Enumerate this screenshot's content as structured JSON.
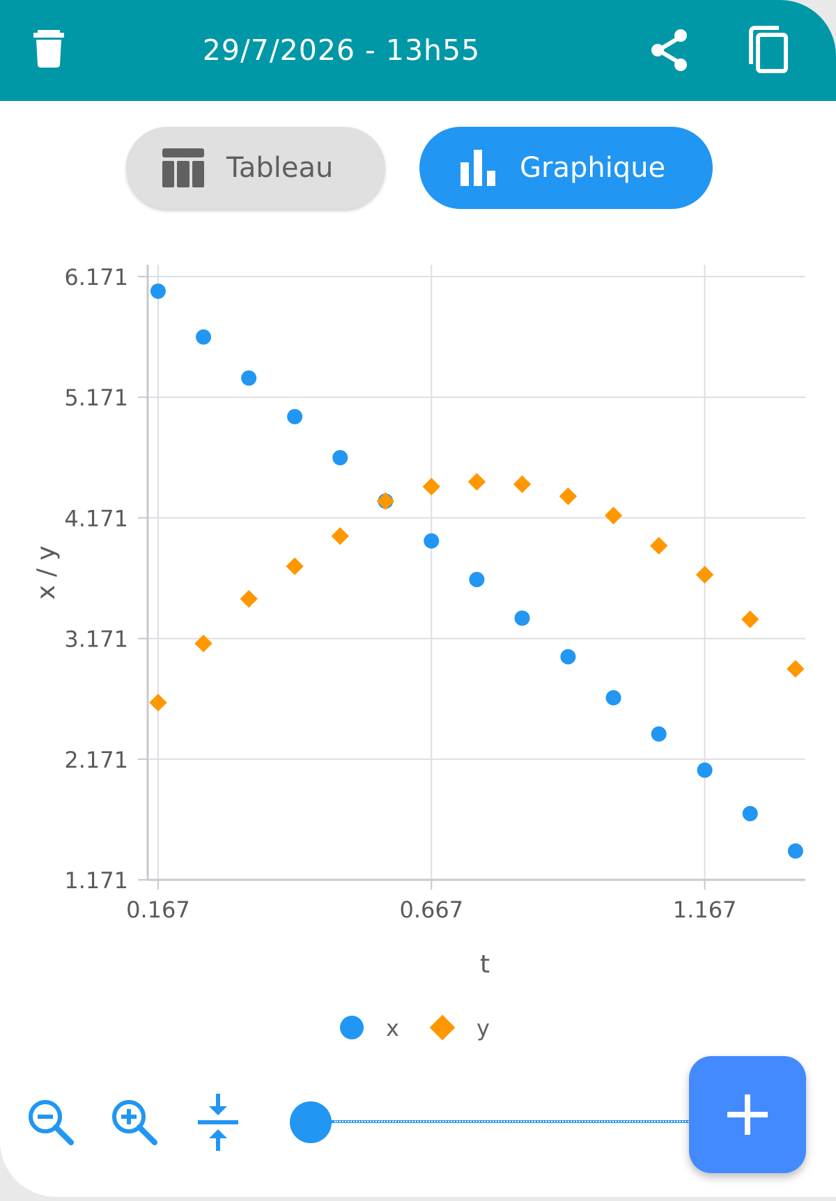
{
  "header": {
    "title": "29/7/2026 - 13h55",
    "icons": {
      "delete": "trash-icon",
      "share": "share-icon",
      "copy": "copy-icon"
    }
  },
  "view_toggle": {
    "tableau_label": "Tableau",
    "graphique_label": "Graphique",
    "selected": "Graphique",
    "icons": {
      "tableau": "table-icon",
      "graphique": "bar-chart-icon"
    }
  },
  "colors": {
    "header_bg": "#0097a7",
    "accent": "#2196f3",
    "series_x": "#2196f3",
    "series_y": "#ff9800",
    "fab": "#448aff"
  },
  "chart_data": {
    "type": "scatter",
    "xlabel": "t",
    "ylabel": "x / y",
    "x_ticks": [
      "0.167",
      "0.667",
      "1.167"
    ],
    "y_ticks": [
      "1.171",
      "2.171",
      "3.171",
      "4.171",
      "5.171",
      "6.171"
    ],
    "xlim": [
      0.148,
      1.351
    ],
    "ylim": [
      1.171,
      6.171
    ],
    "grid": true,
    "legend_position": "bottom",
    "t": [
      0.167,
      0.25,
      0.333,
      0.417,
      0.5,
      0.583,
      0.667,
      0.75,
      0.833,
      0.917,
      1.0,
      1.083,
      1.167,
      1.25,
      1.333
    ],
    "series": [
      {
        "name": "x",
        "marker": "circle",
        "values": [
          6.05,
          5.67,
          5.33,
          5.01,
          4.67,
          4.31,
          3.98,
          3.66,
          3.34,
          3.02,
          2.68,
          2.38,
          2.08,
          1.72,
          1.41
        ]
      },
      {
        "name": "y",
        "marker": "diamond",
        "values": [
          2.64,
          3.13,
          3.5,
          3.77,
          4.02,
          4.31,
          4.43,
          4.47,
          4.45,
          4.35,
          4.19,
          3.94,
          3.7,
          3.33,
          2.92
        ]
      }
    ]
  },
  "bottom_toolbar": {
    "icons": {
      "zoom_out": "zoom-out-icon",
      "zoom_in": "zoom-in-icon",
      "fit": "fit-vertical-icon",
      "add": "plus-icon"
    },
    "slider_position": 0.0
  }
}
